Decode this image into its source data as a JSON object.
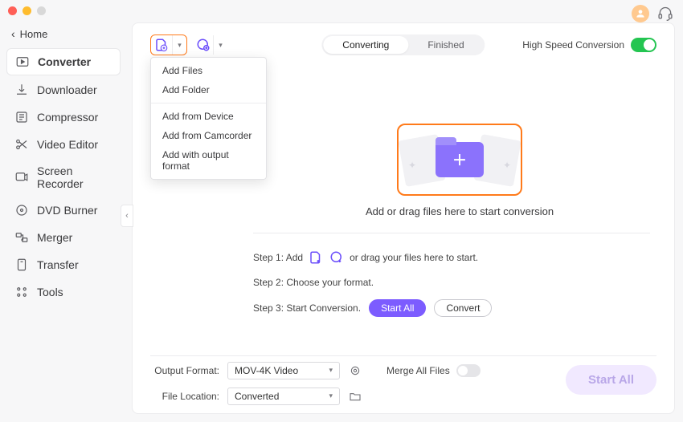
{
  "breadcrumb": {
    "label": "Home"
  },
  "sidebar": {
    "items": [
      {
        "label": "Converter"
      },
      {
        "label": "Downloader"
      },
      {
        "label": "Compressor"
      },
      {
        "label": "Video Editor"
      },
      {
        "label": "Screen Recorder"
      },
      {
        "label": "DVD Burner"
      },
      {
        "label": "Merger"
      },
      {
        "label": "Transfer"
      },
      {
        "label": "Tools"
      }
    ]
  },
  "toolbar": {
    "tabs": {
      "converting": "Converting",
      "finished": "Finished"
    },
    "high_speed_label": "High Speed Conversion"
  },
  "dropdown": {
    "group1": [
      "Add Files",
      "Add Folder"
    ],
    "group2": [
      "Add from Device",
      "Add from Camcorder",
      "Add with output format"
    ]
  },
  "dropzone": {
    "caption": "Add or drag files here to start conversion"
  },
  "steps": {
    "s1_prefix": "Step 1: Add",
    "s1_suffix": "or drag your files here to start.",
    "s2": "Step 2: Choose your format.",
    "s3_prefix": "Step 3: Start Conversion.",
    "start_all": "Start  All",
    "convert": "Convert"
  },
  "bottom": {
    "output_format_label": "Output Format:",
    "output_format_value": "MOV-4K Video",
    "file_location_label": "File Location:",
    "file_location_value": "Converted",
    "merge_label": "Merge All Files",
    "start_all_btn": "Start All"
  }
}
